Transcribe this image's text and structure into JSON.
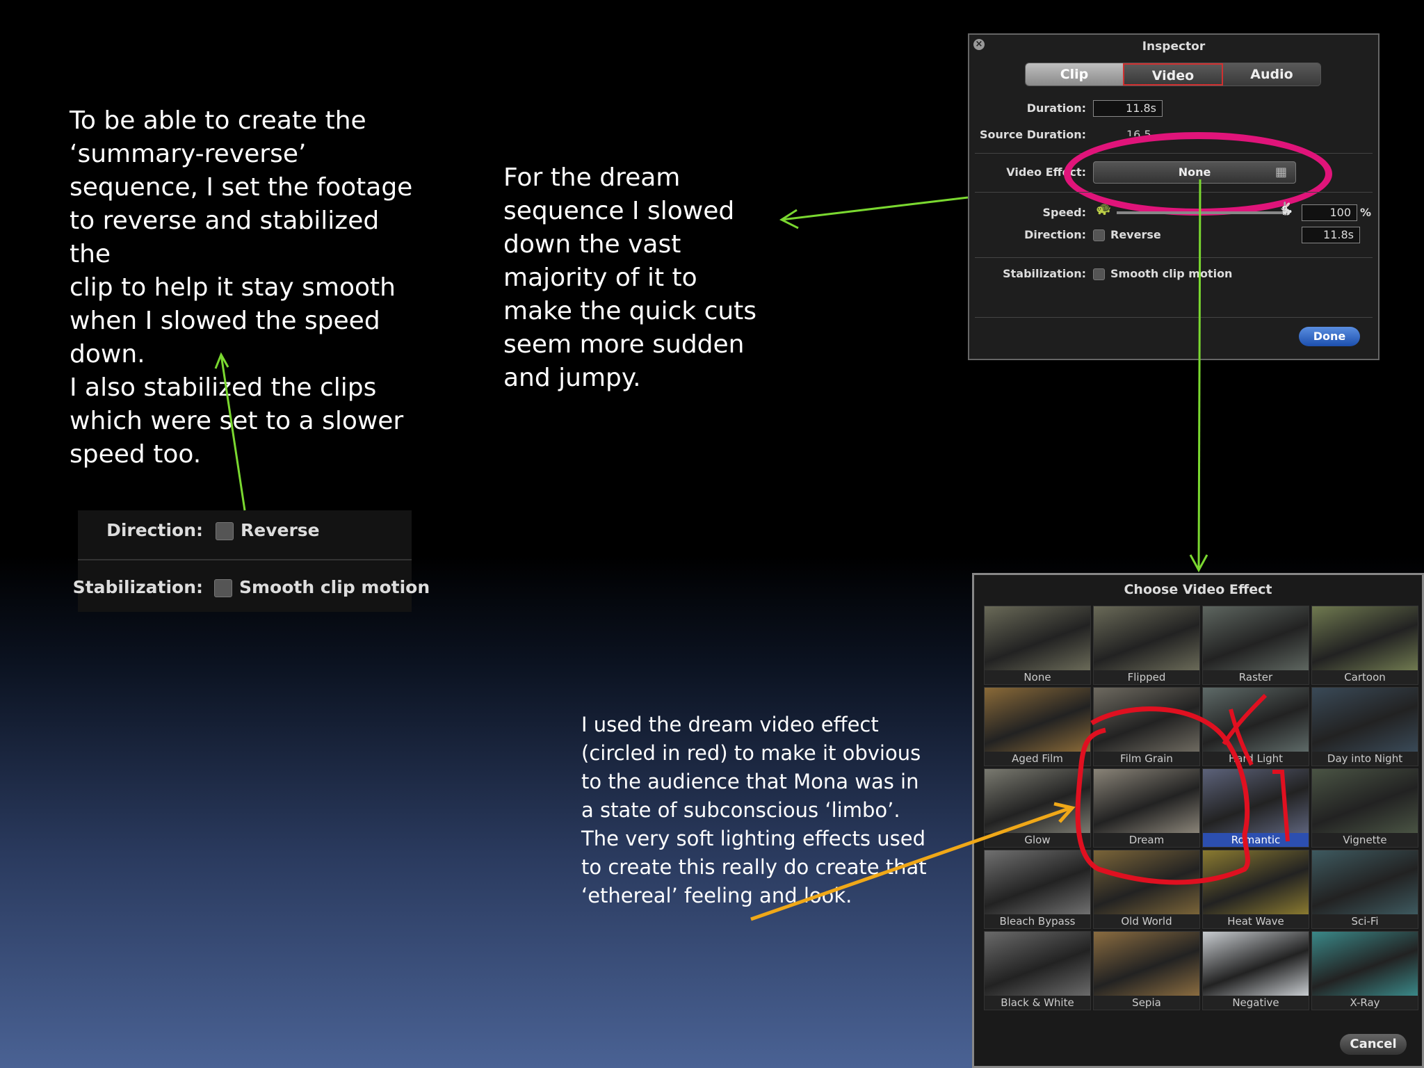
{
  "left_text": [
    "To be able to create the",
    "‘summary-reverse’",
    "sequence, I set the footage",
    "to reverse and stabilized the",
    "clip to help it stay smooth",
    "when I slowed the speed",
    "down.",
    "I also stabilized the clips",
    "which were set to a slower",
    "speed too."
  ],
  "middle_text": "For the dream sequence I slowed down the vast majority of it to make the quick cuts seem more sudden and jumpy.",
  "bottom_text": [
    "I used the dream video effect",
    "(circled in red)  to make it obvious",
    "to the audience that Mona was in",
    "a state of subconscious ‘limbo’.",
    "The very soft lighting effects used",
    "to create this really do create that",
    "‘ethereal’ feeling and look."
  ],
  "inspector": {
    "title": "Inspector",
    "tabs": [
      "Clip",
      "Video",
      "Audio"
    ],
    "duration_label": "Duration:",
    "duration_value": "11.8s",
    "source_duration_label": "Source Duration:",
    "source_duration_value": "16.5",
    "video_effect_label": "Video Effect:",
    "video_effect_value": "None",
    "speed_label": "Speed:",
    "speed_value": "100",
    "speed_unit": "%",
    "direction_label": "Direction:",
    "reverse_label": "Reverse",
    "direction_time": "11.8s",
    "stabilization_label": "Stabilization:",
    "smooth_label": "Smooth clip motion",
    "done_label": "Done"
  },
  "zoom": {
    "direction_label": "Direction:",
    "reverse_label": "Reverse",
    "stabilization_label": "Stabilization:",
    "smooth_label": "Smooth clip motion"
  },
  "chooser": {
    "title": "Choose Video Effect",
    "effects": [
      {
        "label": "None",
        "tone": "#6a6a58"
      },
      {
        "label": "Flipped",
        "tone": "#6a6a58"
      },
      {
        "label": "Raster",
        "tone": "#5e6660"
      },
      {
        "label": "Cartoon",
        "tone": "#707a50"
      },
      {
        "label": "Aged Film",
        "tone": "#8a6a38"
      },
      {
        "label": "Film Grain",
        "tone": "#6e6a60"
      },
      {
        "label": "Hard Light",
        "tone": "#5e6a68"
      },
      {
        "label": "Day into Night",
        "tone": "#3a4a58"
      },
      {
        "label": "Glow",
        "tone": "#7a7a70"
      },
      {
        "label": "Dream",
        "tone": "#8a8478"
      },
      {
        "label": "Romantic",
        "tone": "#5c627a"
      },
      {
        "label": "Vignette",
        "tone": "#4a5444"
      },
      {
        "label": "Bleach Bypass",
        "tone": "#707070"
      },
      {
        "label": "Old World",
        "tone": "#7a6438"
      },
      {
        "label": "Heat Wave",
        "tone": "#8a7a30"
      },
      {
        "label": "Sci-Fi",
        "tone": "#3e5a60"
      },
      {
        "label": "Black & White",
        "tone": "#6a6a6a"
      },
      {
        "label": "Sepia",
        "tone": "#8a6c40"
      },
      {
        "label": "Negative",
        "tone": "#c8ccd0"
      },
      {
        "label": "X-Ray",
        "tone": "#3a8888"
      }
    ],
    "selected": "Romantic",
    "cancel_label": "Cancel"
  },
  "colors": {
    "arrow_green": "#7ad830",
    "circle_pink": "#e0147a",
    "circle_red": "#e01020",
    "arrow_orange": "#f0a818"
  }
}
